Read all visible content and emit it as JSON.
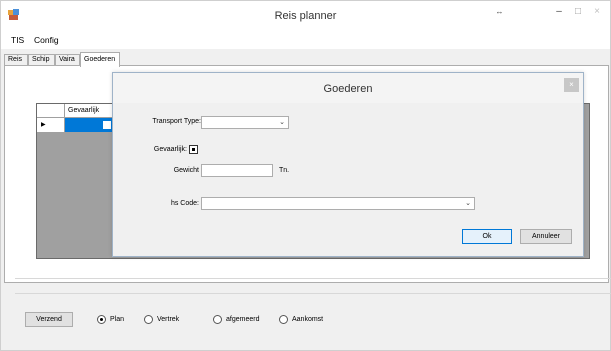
{
  "window": {
    "title": "Reis planner",
    "extra_button": "↔",
    "minimize": "–",
    "maximize": "□",
    "close": "×"
  },
  "menu": {
    "items": [
      "TIS",
      "Config"
    ]
  },
  "tabs": [
    {
      "label": "Reis",
      "active": false
    },
    {
      "label": "Schip",
      "active": false
    },
    {
      "label": "Vaira",
      "active": false
    },
    {
      "label": "Goederen",
      "active": true
    }
  ],
  "grid": {
    "column_header": "Gevaarlijk",
    "row_indicator": "▶"
  },
  "dialog": {
    "title": "Goederen",
    "close": "×",
    "transport_type_label": "Transport Type:",
    "transport_type_value": "",
    "gevaarlijk_label": "Gevaarlijk:",
    "gevaarlijk_checked": true,
    "gewicht_label": "Gewicht",
    "gewicht_value": "",
    "gewicht_unit": "Tn.",
    "hs_code_label": "hs Code:",
    "hs_code_value": "",
    "ok_label": "Ok",
    "annuleer_label": "Annuleer"
  },
  "bottom": {
    "verzend_label": "Verzend",
    "radios": [
      {
        "label": "Plan",
        "checked": true
      },
      {
        "label": "Vertrek",
        "checked": false
      },
      {
        "label": "afgemeerd",
        "checked": false
      },
      {
        "label": "Aankomst",
        "checked": false
      }
    ]
  },
  "colors": {
    "selection": "#0078d7",
    "grid_background": "#a0a0a0"
  },
  "icons": {
    "app": "app-window-icon",
    "dropdown": "chevron-down-icon"
  }
}
